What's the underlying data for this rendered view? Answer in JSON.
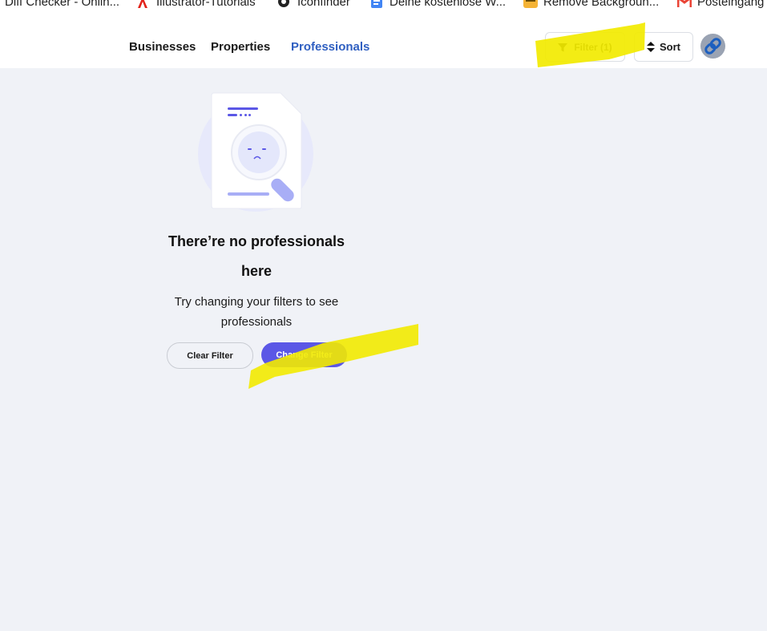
{
  "bookmarks": [
    {
      "label": "Diff Checker - Onlin...",
      "icon": "diffchecker-icon"
    },
    {
      "label": "Illustrator-Tutorials",
      "icon": "adobe-icon"
    },
    {
      "label": "Iconfinder",
      "icon": "iconfinder-icon"
    },
    {
      "label": "Deine kostenlose W...",
      "icon": "docs-icon"
    },
    {
      "label": "Remove Backgroun...",
      "icon": "removebg-icon"
    },
    {
      "label": "Posteingang",
      "icon": "gmail-icon"
    }
  ],
  "nav": {
    "tabs": [
      {
        "label": "Businesses",
        "active": false
      },
      {
        "label": "Properties",
        "active": false
      },
      {
        "label": "Professionals",
        "active": true
      }
    ]
  },
  "toolbar": {
    "filter_label": "Filter (1)",
    "sort_label": "Sort"
  },
  "empty_state": {
    "title": "There’re no professionals here",
    "subtitle": "Try changing your filters to see professionals",
    "clear_label": "Clear Filter",
    "change_label": "Change Filter"
  },
  "colors": {
    "accent": "#5b57e6",
    "active_tab": "#2f5fc1",
    "highlight": "#f2ea00",
    "background": "#f0f2f7"
  }
}
